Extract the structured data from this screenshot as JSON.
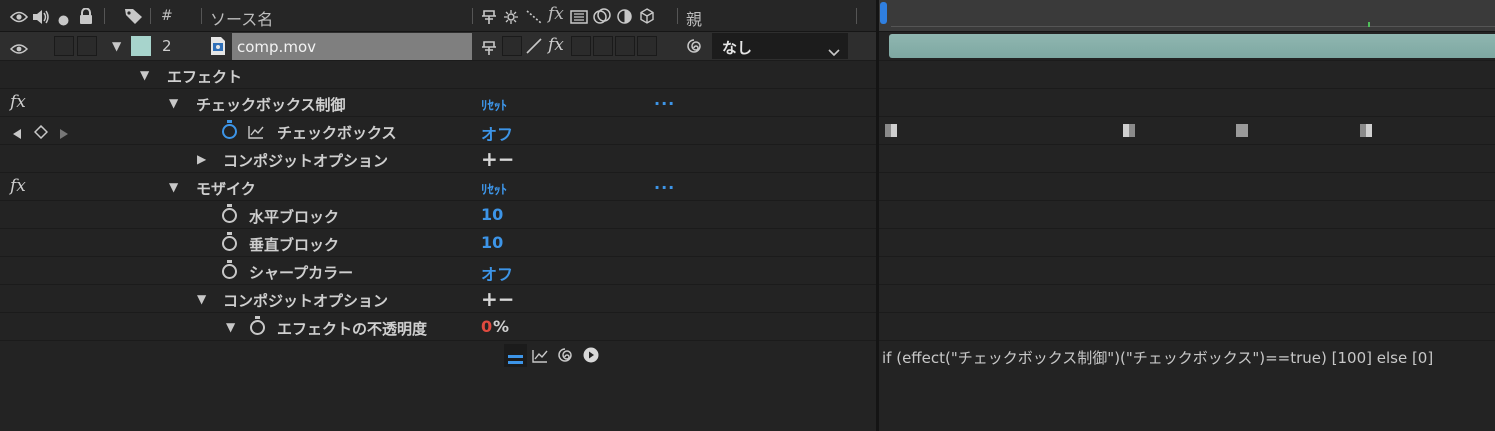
{
  "header": {
    "hash": "#",
    "source_name": "ソース名",
    "fx": "fx",
    "parent": "親"
  },
  "layer": {
    "number": "2",
    "name": "comp.mov",
    "fx": "fx",
    "parent_value": "なし",
    "label_color": "#a7d4cc"
  },
  "rows": {
    "effects_label": "エフェクト",
    "checkbox_control": "チェックボックス制御",
    "checkbox_control_reset": "ﾘｾｯﾄ",
    "checkbox_control_more": "...",
    "checkbox_prop": "チェックボックス",
    "checkbox_value": "オフ",
    "composite_1": "コンポジットオプション",
    "composite_1_value": "+−",
    "mosaic": "モザイク",
    "mosaic_reset": "ﾘｾｯﾄ",
    "mosaic_more": "...",
    "h_blocks": "水平ブロック",
    "h_blocks_value": "10",
    "v_blocks": "垂直ブロック",
    "v_blocks_value": "10",
    "sharp_colors": "シャープカラー",
    "sharp_colors_value": "オフ",
    "composite_2": "コンポジットオプション",
    "composite_2_value": "+−",
    "effect_opacity": "エフェクトの不透明度",
    "effect_opacity_number": "0",
    "effect_opacity_unit": "%",
    "fx_glyph": "fx"
  },
  "timeline": {
    "expression": "if  (effect(\"チェックボックス制御\")(\"チェックボックス\")==true) [100]  else [0]",
    "clip_color": "#8fb6b0",
    "keyframe_positions": [
      0.0,
      0.44,
      0.65,
      0.88
    ]
  },
  "colors": {
    "accent": "#3d95e8",
    "red_value": "#e04a3f"
  }
}
